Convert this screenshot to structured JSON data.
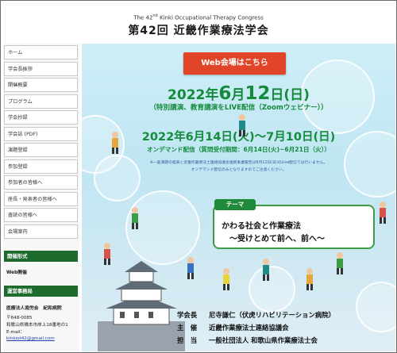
{
  "header": {
    "congress_prefix": "The 42",
    "congress_sup": "nd",
    "congress_suffix": " Kinki Occupational Therapy Congress",
    "title": "第42回 近畿作業療法学会"
  },
  "sidebar": {
    "nav": [
      "ホーム",
      "学会長挨拶",
      "開催概要",
      "プログラム",
      "学会抄録",
      "学会誌 (PDF)",
      "演題登録",
      "参加登録",
      "参加者の皆様へ",
      "座長・発表者の皆様へ",
      "査読の皆様へ",
      "会場案内"
    ],
    "section_format": "開催形式",
    "format_text": "Web開催",
    "section_office": "運営事務局",
    "office_lines": [
      "医療法人南労会　紀和病院",
      "〒648-0085",
      "和歌山県橋本市岸上18番地の1",
      "E-mail："
    ],
    "office_email": "kinkiot42@gmail.com"
  },
  "banner": {
    "web_button": "Web会場はこちら",
    "date1_year": "2022年",
    "date1_month": "6",
    "date1_mid": "月",
    "date1_day": "12",
    "date1_rest": "日(日)",
    "date1_sub": "（特別講演、教育講演をLIVE配信（Zoomウェビナー））",
    "date2": "2022年6月14日(火)～7月10日(日)",
    "date2_sub": "オンデマンド配信（質問受付期間：6月14日(火)~6月21日（火））",
    "note1": "※一般演題の発表と近畿作業療法士連絡協議会連携事業報告は6月12日(日)のLive配信では行いません。",
    "note2": "オンデマンド配信のみとなりますのでご注意ください。",
    "theme_tag": "テーマ",
    "theme_line1": "かわる社会と作業療法",
    "theme_line2": "～受けとめて前へ、前へ～",
    "credits": [
      {
        "role": "学会長",
        "name": "尼寺謙仁（伏虎リハビリテーション病院）"
      },
      {
        "role": "主　催",
        "name": "近畿作業療法士連絡協議会"
      },
      {
        "role": "担　当",
        "name": "一般社団法人 和歌山県作業療法士会"
      }
    ]
  }
}
